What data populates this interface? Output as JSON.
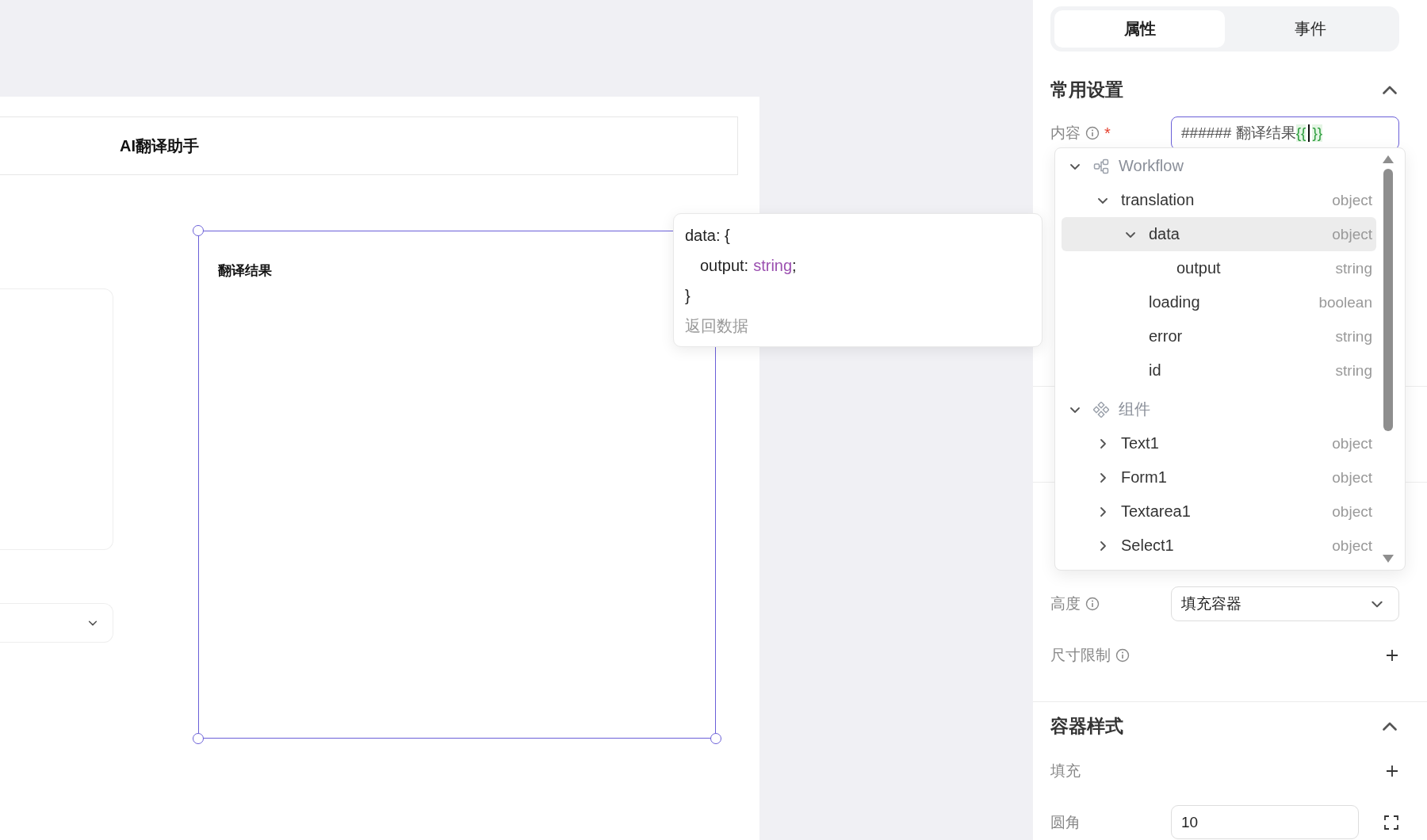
{
  "canvas": {
    "header": {
      "title": "AI翻译助手"
    },
    "selected_component": {
      "label": "翻译结果",
      "selected": true
    }
  },
  "tooltip": {
    "open": "data: {",
    "fields": [
      {
        "name": "output:",
        "type": "string",
        "end": ";"
      }
    ],
    "close": "}",
    "description": "返回数据"
  },
  "panel": {
    "tabs": [
      {
        "label": "属性",
        "selected": true
      },
      {
        "label": "事件",
        "selected": false
      }
    ],
    "content_field": {
      "label": "内容",
      "info": true,
      "required_mark": "*",
      "value": "###### 翻译结果",
      "binding_open": "{{",
      "binding_close": "}}"
    },
    "common_section": {
      "title": "常用设置",
      "expanded": true
    },
    "height_row": {
      "label": "高度",
      "info": true,
      "value": "填充容器"
    },
    "size_limit_row": {
      "label": "尺寸限制",
      "info": true
    },
    "container_section": {
      "title": "容器样式",
      "expanded": true
    },
    "fill_row": {
      "label": "填充"
    },
    "radius_row": {
      "label": "圆角",
      "value": "10"
    }
  },
  "variable_picker": {
    "groups": [
      {
        "kind": "workflow",
        "name": "Workflow",
        "expanded": true,
        "children": [
          {
            "name": "translation",
            "type": "object",
            "expanded": true,
            "selected": false,
            "children": [
              {
                "name": "data",
                "type": "object",
                "expanded": true,
                "selected": true,
                "children": [
                  {
                    "name": "output",
                    "type": "string",
                    "selected": false
                  }
                ]
              },
              {
                "name": "loading",
                "type": "boolean",
                "selected": false
              },
              {
                "name": "error",
                "type": "string",
                "selected": false
              },
              {
                "name": "id",
                "type": "string",
                "selected": false
              }
            ]
          }
        ]
      },
      {
        "kind": "components",
        "name": "组件",
        "expanded": true,
        "children": [
          {
            "name": "Text1",
            "type": "object",
            "expanded": false,
            "selected": false
          },
          {
            "name": "Form1",
            "type": "object",
            "expanded": false,
            "selected": false
          },
          {
            "name": "Textarea1",
            "type": "object",
            "expanded": false,
            "selected": false
          },
          {
            "name": "Select1",
            "type": "object",
            "expanded": false,
            "selected": false
          }
        ]
      }
    ]
  }
}
